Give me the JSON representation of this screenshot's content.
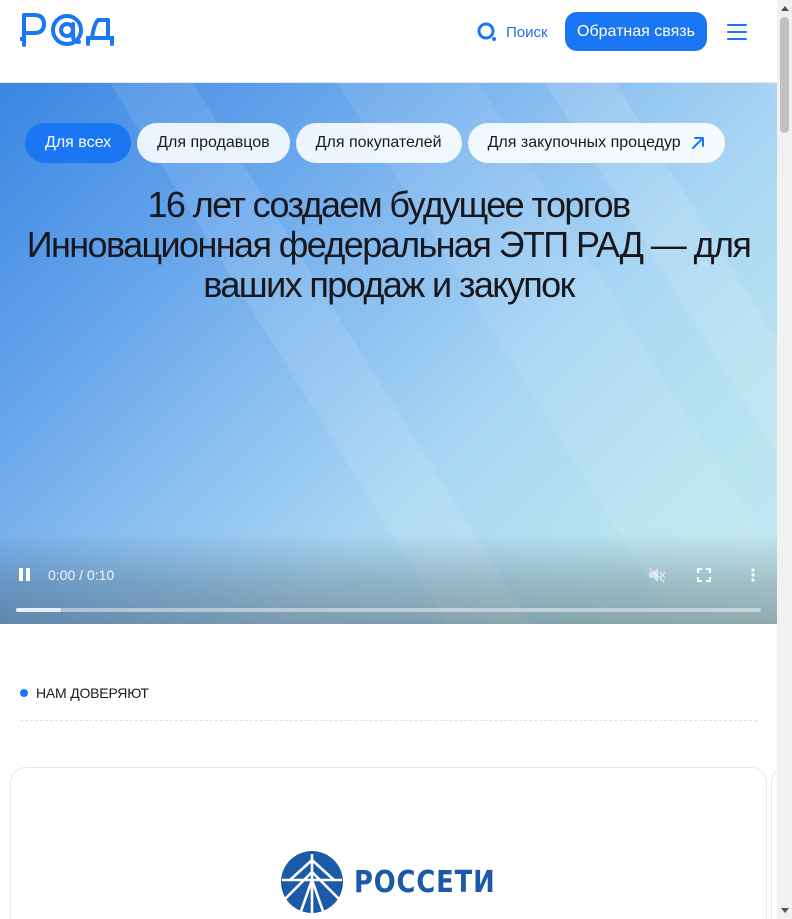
{
  "header": {
    "logo_text": "РАД",
    "search_label": "Поиск",
    "feedback_label": "Обратная связь"
  },
  "hero": {
    "tabs": [
      {
        "label": "Для всех",
        "active": true
      },
      {
        "label": "Для продавцов",
        "active": false
      },
      {
        "label": "Для покупателей",
        "active": false
      },
      {
        "label": "Для закупочных процедур",
        "active": false,
        "icon": "arrow-up-right-icon"
      }
    ],
    "headline_line1": "16 лет создаем будущее торгов",
    "headline_line2": "Инновационная федеральная ЭТП РАД — для",
    "headline_line3": "ваших продаж и закупок",
    "video": {
      "time": "0:00 / 0:10",
      "progress": 0.06
    }
  },
  "trust": {
    "title": "НАМ ДОВЕРЯЮТ",
    "partners": [
      {
        "name": "РОССЕТИ"
      }
    ]
  },
  "colors": {
    "accent": "#1a76f2",
    "rosseti": "#1a5aa8"
  }
}
